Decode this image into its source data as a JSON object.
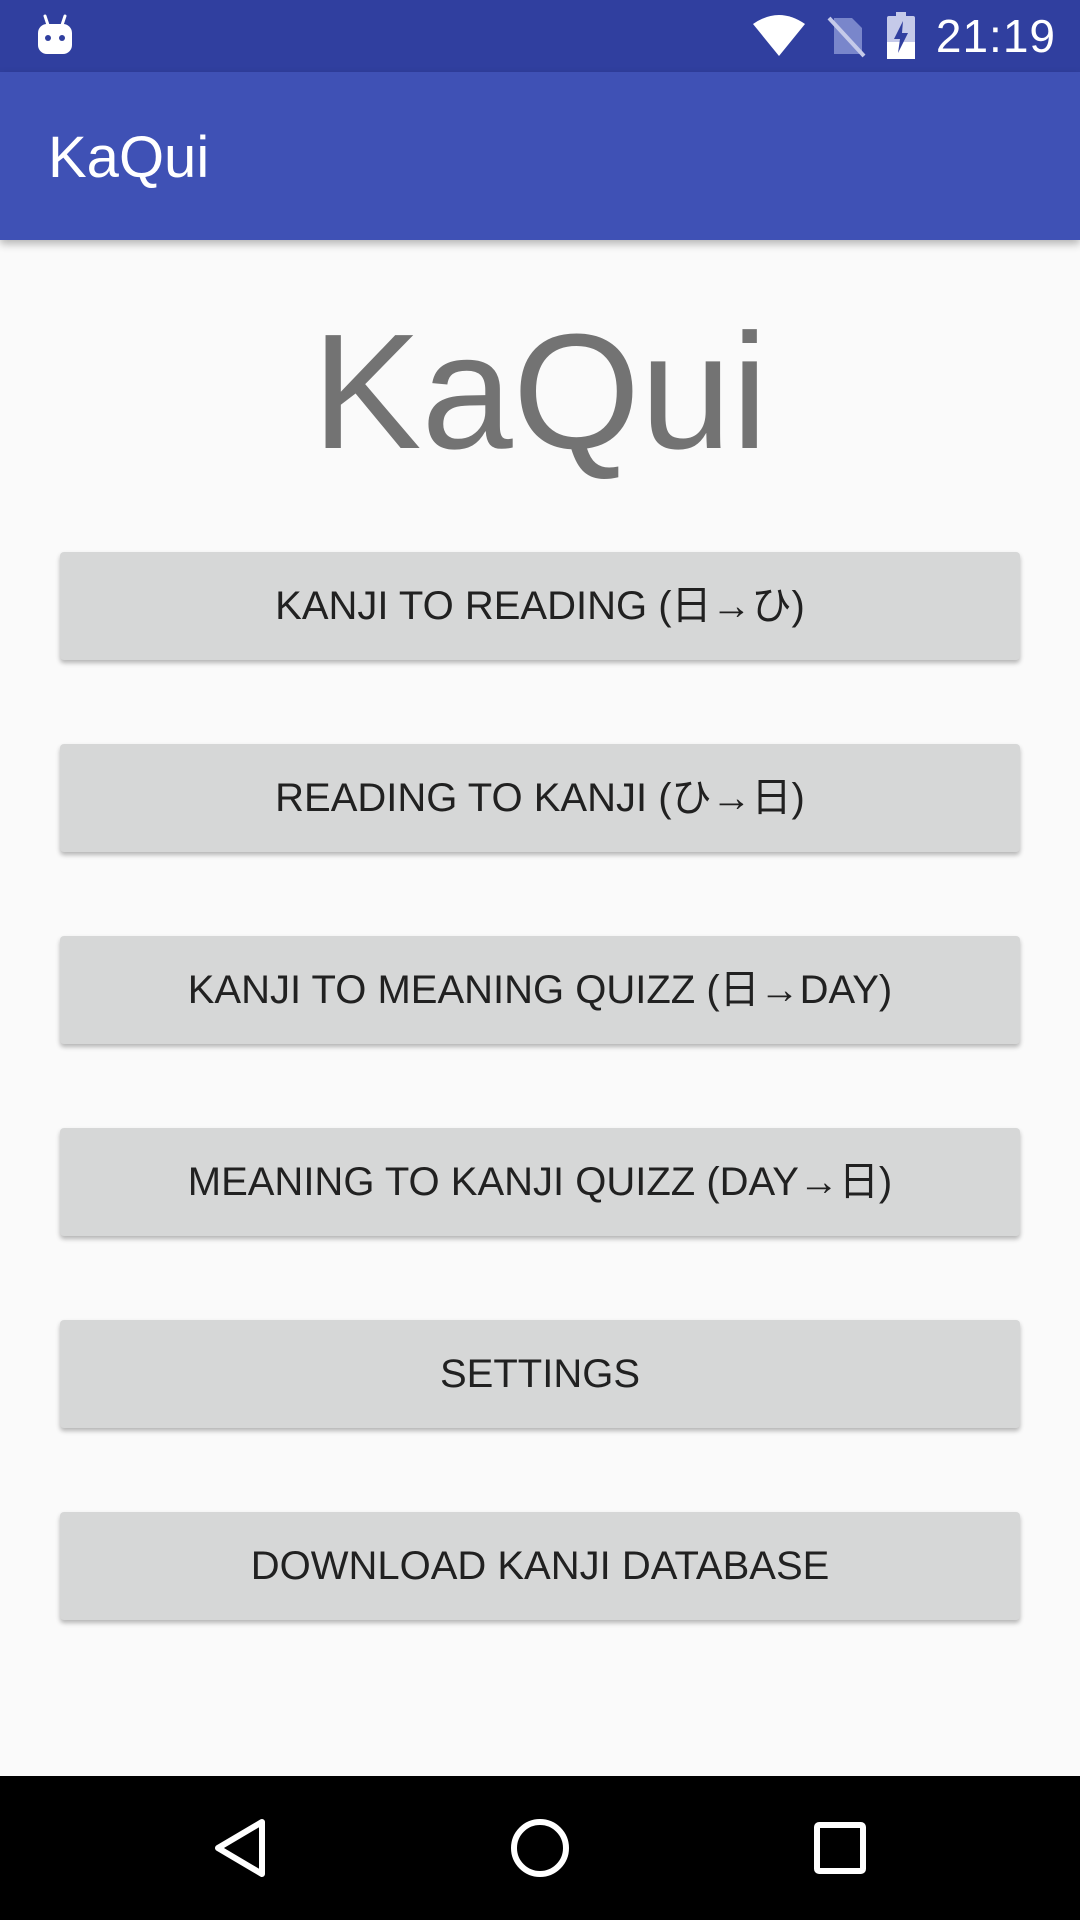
{
  "status_bar": {
    "time": "21:19",
    "icons": [
      "android-notification-icon",
      "wifi-icon",
      "no-sim-icon",
      "battery-charging-icon"
    ]
  },
  "app_bar": {
    "title": "KaQui"
  },
  "main": {
    "logo_text": "KaQui",
    "buttons": [
      {
        "label": "KANJI TO READING (日→ひ)"
      },
      {
        "label": "READING TO KANJI (ひ→日)"
      },
      {
        "label": "KANJI TO MEANING QUIZZ (日→DAY)"
      },
      {
        "label": "MEANING TO KANJI QUIZZ (DAY→日)"
      },
      {
        "label": "SETTINGS"
      },
      {
        "label": "DOWNLOAD KANJI DATABASE"
      }
    ]
  },
  "nav_bar": {
    "icons": [
      "back-icon",
      "home-icon",
      "recents-icon"
    ]
  },
  "colors": {
    "status_bar": "#303f9f",
    "app_bar": "#3f51b5",
    "background": "#fafafa",
    "button": "#d6d7d7",
    "logo_text": "#737373"
  }
}
